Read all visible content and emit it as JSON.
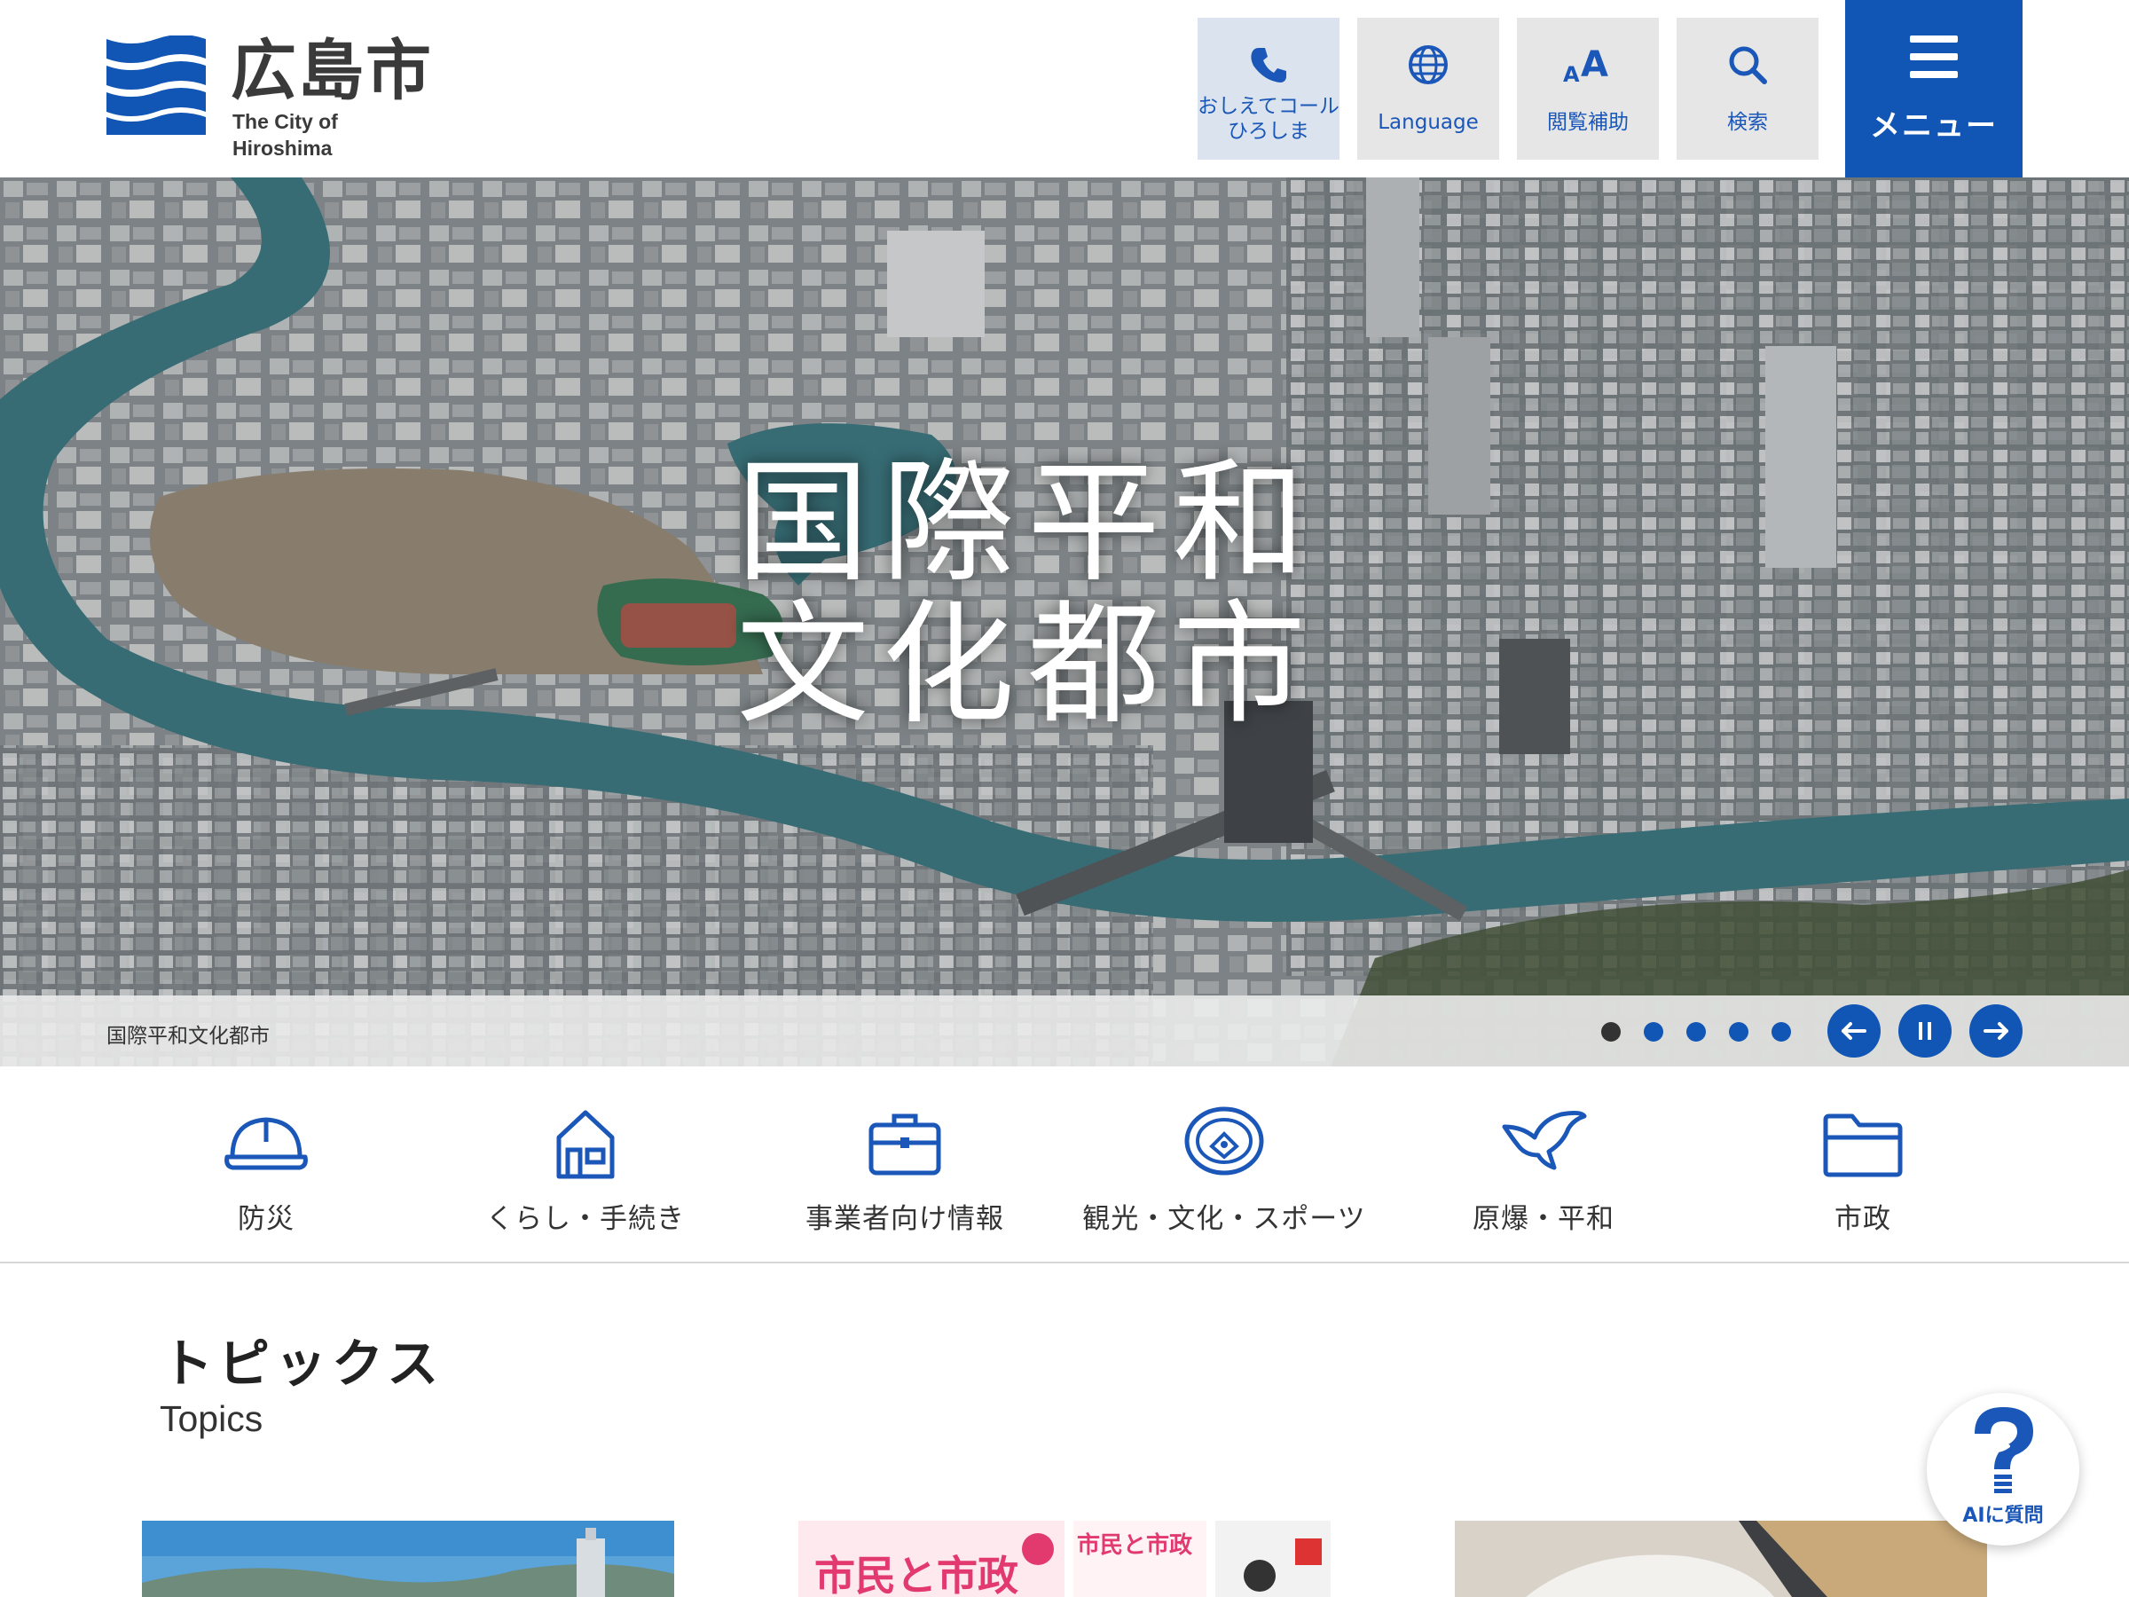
{
  "header": {
    "logo_ja": "広島市",
    "logo_en": "The City of Hiroshima",
    "buttons": {
      "call": "おしえてコール\nひろしま",
      "language": "Language",
      "accessibility": "閲覧補助",
      "search": "検索"
    },
    "menu": "メニュー"
  },
  "hero": {
    "title_line1": "国際平和",
    "title_line2": "文化都市",
    "caption": "国際平和文化都市",
    "slide_count": 5,
    "active_slide": 1
  },
  "categories": [
    {
      "label": "防災",
      "icon": "helmet-icon"
    },
    {
      "label": "くらし・手続き",
      "icon": "house-icon"
    },
    {
      "label": "事業者向け情報",
      "icon": "briefcase-icon"
    },
    {
      "label": "観光・文化・スポーツ",
      "icon": "stadium-icon"
    },
    {
      "label": "原爆・平和",
      "icon": "dove-icon"
    },
    {
      "label": "市政",
      "icon": "folder-icon"
    }
  ],
  "topics": {
    "title_ja": "トピックス",
    "title_en": "Topics"
  },
  "ai_fab": {
    "label": "AIに質問"
  },
  "colors": {
    "brand": "#1155b5",
    "header_button_bg": "#e6e6e6",
    "text": "#333333"
  }
}
